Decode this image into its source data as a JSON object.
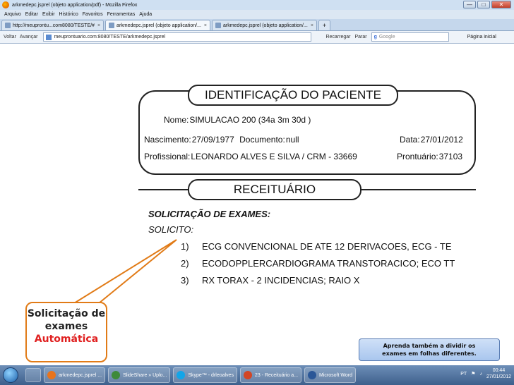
{
  "window": {
    "title": "arkmedepc.jsprel (objeto application/pdf) - Mozilla Firefox",
    "controls": {
      "minimize": "—",
      "maximize": "□",
      "close": "✕"
    }
  },
  "menu": [
    "Arquivo",
    "Editar",
    "Exibir",
    "Histórico",
    "Favoritos",
    "Ferramentas",
    "Ajuda"
  ],
  "tabs": [
    {
      "label": "http://meuprontu...com8080/TESTE/#"
    },
    {
      "label": "arkmedepc.jsprel (objeto application/..."
    },
    {
      "label": "arkmedepc.jsprel (objeto application/..."
    },
    {
      "label": "+"
    }
  ],
  "nav": {
    "back": "Voltar",
    "forward": "Avançar",
    "url": "meuprontuario.com:8080/TESTE/arkmedepc.jsprel",
    "reload": "Recarregar",
    "stop": "Parar",
    "search_placeholder": "Google",
    "home": "Página inicial"
  },
  "document": {
    "header_title": "IDENTIFICAÇÃO DO PACIENTE",
    "nome_label": "Nome:",
    "nome_value": "SIMULACAO 200 (34a 3m 30d )",
    "nascimento_label": "Nascimento:",
    "nascimento_value": "27/09/1977",
    "documento_label": "Documento:",
    "documento_value": "null",
    "data_label": "Data:",
    "data_value": "27/01/2012",
    "profissional_label": "Profissional:",
    "profissional_value": "LEONARDO ALVES E SILVA / CRM - 33669",
    "prontuario_label": "Prontuário:",
    "prontuario_value": "37103",
    "section_title": "RECEITUÁRIO",
    "solicitacao_title": "SOLICITAÇÃO DE EXAMES:",
    "solicito": "SOLICITO:",
    "exams": [
      {
        "num": "1)",
        "text": "ECG CONVENCIONAL DE ATE 12 DERIVACOES, ECG - TE"
      },
      {
        "num": "2)",
        "text": "ECODOPPLERCARDIOGRAMA TRANSTORACICO; ECO TT"
      },
      {
        "num": "3)",
        "text": "RX TORAX - 2 INCIDENCIAS; RAIO X"
      }
    ]
  },
  "callout": {
    "line1": "Solicitação de",
    "line2": "exames",
    "line3": "Automática",
    "border_color": "#e17b17",
    "highlight_color": "#e02020"
  },
  "tip": {
    "line1": "Aprenda também a dividir os",
    "line2": "exames em folhas diferentes."
  },
  "taskbar": {
    "items": [
      {
        "label": "arkmedepc.jsprel ...",
        "icon": "firefox-icon"
      },
      {
        "label": "SlideShare » Uplo...",
        "icon": "chrome-icon"
      },
      {
        "label": "Skype™ - drleoalves",
        "icon": "skype-icon"
      },
      {
        "label": "23 - Receituário a...",
        "icon": "powerpoint-icon"
      },
      {
        "label": "Microsoft Word",
        "icon": "word-icon"
      }
    ],
    "language": "PT",
    "time": "00:44",
    "date": "27/01/2012"
  }
}
